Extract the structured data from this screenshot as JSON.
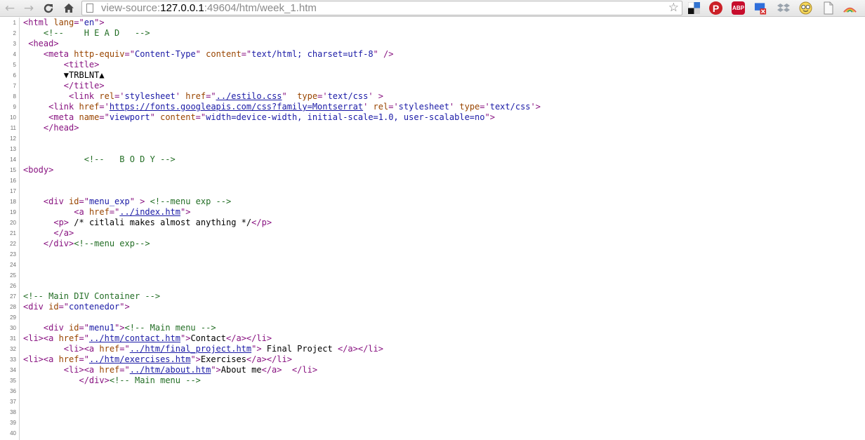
{
  "browser": {
    "url": {
      "scheme": "view-source:",
      "host": "127.0.0.1",
      "path": ":49604/htm/week_1.htm"
    },
    "icons": [
      "back-arrow-icon",
      "forward-arrow-icon",
      "reload-icon",
      "home-icon",
      "page-icon",
      "bookmark-star-icon",
      "delicious-extension-icon",
      "pinterest-extension-icon",
      "adblock-plus-extension-icon",
      "screen-capture-extension-icon",
      "dropbox-extension-icon",
      "smiley-extension-icon",
      "document-extension-icon",
      "rainbow-extension-icon"
    ],
    "abp_label": "ABP"
  },
  "source": {
    "colors": {
      "tag": "#881280",
      "attr_name": "#994500",
      "attr_value": "#1a1aa6",
      "comment": "#236e25",
      "line_number": "#707070"
    },
    "lines": [
      [
        [
          "t",
          "<html "
        ],
        [
          "an",
          "lang"
        ],
        [
          "t",
          "=\""
        ],
        [
          "av",
          "en"
        ],
        [
          "t",
          "\">"
        ]
      ],
      [
        [
          "",
          "    "
        ],
        [
          "cm",
          "<!--    H E A D   -->"
        ]
      ],
      [
        [
          "t",
          " <head>"
        ]
      ],
      [
        [
          "",
          "    "
        ],
        [
          "t",
          "<meta "
        ],
        [
          "an",
          "http-equiv"
        ],
        [
          "t",
          "=\""
        ],
        [
          "av",
          "Content-Type"
        ],
        [
          "t",
          "\" "
        ],
        [
          "an",
          "content"
        ],
        [
          "t",
          "=\""
        ],
        [
          "av",
          "text/html; charset=utf-8"
        ],
        [
          "t",
          "\" />"
        ]
      ],
      [
        [
          "",
          "        "
        ],
        [
          "t",
          "<title>"
        ]
      ],
      [
        [
          "",
          "        ▼TRBLNT▲"
        ]
      ],
      [
        [
          "",
          "        "
        ],
        [
          "t",
          "</title>"
        ]
      ],
      [
        [
          "",
          "         "
        ],
        [
          "t",
          "<link "
        ],
        [
          "an",
          "rel"
        ],
        [
          "t",
          "='"
        ],
        [
          "av",
          "stylesheet"
        ],
        [
          "t",
          "' "
        ],
        [
          "an",
          "href"
        ],
        [
          "t",
          "=\""
        ],
        [
          "lk",
          "../estilo.css"
        ],
        [
          "t",
          "\"  "
        ],
        [
          "an",
          "type"
        ],
        [
          "t",
          "='"
        ],
        [
          "av",
          "text/css"
        ],
        [
          "t",
          "' >"
        ]
      ],
      [
        [
          "",
          "     "
        ],
        [
          "t",
          "<link "
        ],
        [
          "an",
          "href"
        ],
        [
          "t",
          "='"
        ],
        [
          "lk",
          "https://fonts.googleapis.com/css?family=Montserrat"
        ],
        [
          "t",
          "' "
        ],
        [
          "an",
          "rel"
        ],
        [
          "t",
          "='"
        ],
        [
          "av",
          "stylesheet"
        ],
        [
          "t",
          "' "
        ],
        [
          "an",
          "type"
        ],
        [
          "t",
          "='"
        ],
        [
          "av",
          "text/css"
        ],
        [
          "t",
          "'>"
        ]
      ],
      [
        [
          "",
          "     "
        ],
        [
          "t",
          "<meta "
        ],
        [
          "an",
          "name"
        ],
        [
          "t",
          "=\""
        ],
        [
          "av",
          "viewport"
        ],
        [
          "t",
          "\" "
        ],
        [
          "an",
          "content"
        ],
        [
          "t",
          "=\""
        ],
        [
          "av",
          "width=device-width, initial-scale=1.0, user-scalable=no"
        ],
        [
          "t",
          "\">"
        ]
      ],
      [
        [
          "",
          "    "
        ],
        [
          "t",
          "</head>"
        ]
      ],
      [],
      [],
      [
        [
          "",
          "            "
        ],
        [
          "cm",
          "<!--   B O D Y -->"
        ]
      ],
      [
        [
          "t",
          "<body>"
        ]
      ],
      [],
      [],
      [
        [
          "",
          "    "
        ],
        [
          "t",
          "<div "
        ],
        [
          "an",
          "id"
        ],
        [
          "t",
          "=\""
        ],
        [
          "av",
          "menu_exp"
        ],
        [
          "t",
          "\" > "
        ],
        [
          "cm",
          "<!--menu exp -->"
        ]
      ],
      [
        [
          "",
          "          "
        ],
        [
          "t",
          "<a "
        ],
        [
          "an",
          "href"
        ],
        [
          "t",
          "=\""
        ],
        [
          "lk",
          "../index.htm"
        ],
        [
          "t",
          "\">"
        ]
      ],
      [
        [
          "",
          "      "
        ],
        [
          "t",
          "<p>"
        ],
        [
          "",
          " /* citlali makes almost anything */"
        ],
        [
          "t",
          "</p>"
        ]
      ],
      [
        [
          "",
          "      "
        ],
        [
          "t",
          "</a>"
        ]
      ],
      [
        [
          "",
          "    "
        ],
        [
          "t",
          "</div>"
        ],
        [
          "cm",
          "<!--menu exp-->"
        ]
      ],
      [],
      [],
      [],
      [],
      [
        [
          "cm",
          "<!-- Main DIV Container -->"
        ]
      ],
      [
        [
          "t",
          "<div "
        ],
        [
          "an",
          "id"
        ],
        [
          "t",
          "=\""
        ],
        [
          "av",
          "contenedor"
        ],
        [
          "t",
          "\">"
        ]
      ],
      [],
      [
        [
          "",
          "    "
        ],
        [
          "t",
          "<div "
        ],
        [
          "an",
          "id"
        ],
        [
          "t",
          "=\""
        ],
        [
          "av",
          "menu1"
        ],
        [
          "t",
          "\">"
        ],
        [
          "cm",
          "<!-- Main menu -->"
        ]
      ],
      [
        [
          "t",
          "<li><a "
        ],
        [
          "an",
          "href"
        ],
        [
          "t",
          "=\""
        ],
        [
          "lk",
          "../htm/contact.htm"
        ],
        [
          "t",
          "\">"
        ],
        [
          "",
          "Contact"
        ],
        [
          "t",
          "</a></li>"
        ]
      ],
      [
        [
          "",
          "        "
        ],
        [
          "t",
          "<li><a "
        ],
        [
          "an",
          "href"
        ],
        [
          "t",
          "=\""
        ],
        [
          "lk",
          "../htm/final_project.htm"
        ],
        [
          "t",
          "\">"
        ],
        [
          "",
          " Final Project "
        ],
        [
          "t",
          "</a></li>"
        ]
      ],
      [
        [
          "t",
          "<li><a "
        ],
        [
          "an",
          "href"
        ],
        [
          "t",
          "=\""
        ],
        [
          "lk",
          "../htm/exercises.htm"
        ],
        [
          "t",
          "\">"
        ],
        [
          "",
          "Exercises"
        ],
        [
          "t",
          "</a></li>"
        ]
      ],
      [
        [
          "",
          "        "
        ],
        [
          "t",
          "<li><a "
        ],
        [
          "an",
          "href"
        ],
        [
          "t",
          "=\""
        ],
        [
          "lk",
          "../htm/about.htm"
        ],
        [
          "t",
          "\">"
        ],
        [
          "",
          "About me"
        ],
        [
          "t",
          "</a>  </li>"
        ]
      ],
      [
        [
          "",
          "           "
        ],
        [
          "t",
          "</div>"
        ],
        [
          "cm",
          "<!-- Main menu -->"
        ]
      ],
      [],
      [],
      [],
      [],
      []
    ]
  }
}
